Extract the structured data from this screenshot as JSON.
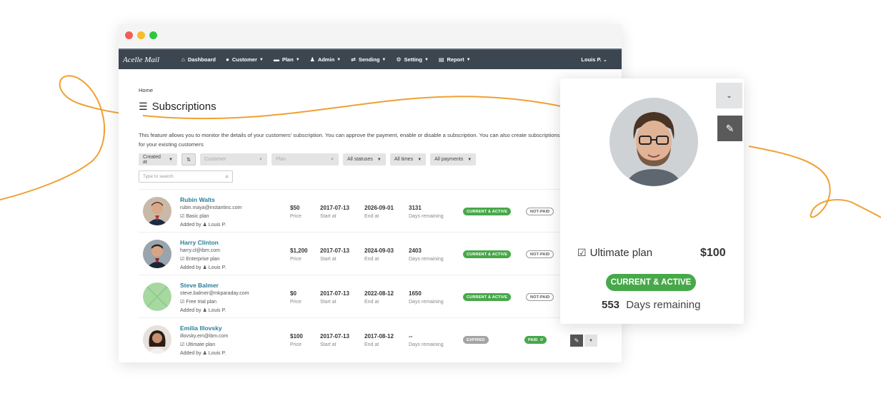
{
  "window": {
    "title_dots": [
      "red",
      "yellow",
      "green"
    ]
  },
  "brand": "Acelle Mail",
  "nav": [
    {
      "label": "Dashboard",
      "icon": "home-icon",
      "caret": false
    },
    {
      "label": "Customer",
      "icon": "user-icon",
      "caret": true
    },
    {
      "label": "Plan",
      "icon": "card-icon",
      "caret": true
    },
    {
      "label": "Admin",
      "icon": "admin-icon",
      "caret": true
    },
    {
      "label": "Sending",
      "icon": "exchange-icon",
      "caret": true
    },
    {
      "label": "Setting",
      "icon": "gear-icon",
      "caret": true
    },
    {
      "label": "Report",
      "icon": "report-icon",
      "caret": true
    }
  ],
  "user_menu": "Louis P. ⌄",
  "breadcrumb": "Home",
  "page_title": "Subscriptions",
  "description": "This feature allows you to monitor the details of your customers' subscription. You can approve the payment, enable or disable a subscription. You can also create subscriptions for your existing customers",
  "filters": {
    "created_at": "Created at",
    "customer": "Customer",
    "plan": "Plan",
    "statuses": "All statuses",
    "times": "All times",
    "payments": "All payments",
    "search_placeholder": "Type to search"
  },
  "labels": {
    "price": "Price",
    "start": "Start at",
    "end": "End at",
    "remaining": "Days remaining",
    "added_by": "Added by",
    "added_user": "Louis P."
  },
  "subscriptions": [
    {
      "name": "Rubin Walts",
      "email": "rubin.maya@instantinc.com",
      "plan": "Basic plan",
      "price": "$50",
      "start": "2017-07-13",
      "end": "2026-09-01",
      "days": "3131",
      "status": "CURRENT & ACTIVE",
      "payment": "NOT-PAID"
    },
    {
      "name": "Harry Clinton",
      "email": "harry.cl@ibm.com",
      "plan": "Enterprise plan",
      "price": "$1,200",
      "start": "2017-07-13",
      "end": "2024-09-03",
      "days": "2403",
      "status": "CURRENT & ACTIVE",
      "payment": "NOT-PAID"
    },
    {
      "name": "Steve Balmer",
      "email": "steve.balmer@mkparaday.com",
      "plan": "Free trial plan",
      "price": "$0",
      "start": "2017-07-13",
      "end": "2022-08-12",
      "days": "1650",
      "status": "CURRENT & ACTIVE",
      "payment": "NOT-PAID"
    },
    {
      "name": "Emilia Illovsky",
      "email": "illovsky.em@ibm.com",
      "plan": "Ultimate plan",
      "price": "$100",
      "start": "2017-07-13",
      "end": "2017-08-12",
      "days": "--",
      "status": "EXPIRED",
      "payment": "PAID"
    }
  ],
  "detail_card": {
    "plan": "Ultimate plan",
    "price": "$100",
    "status": "CURRENT & ACTIVE",
    "days": "553",
    "days_label": "Days remaining"
  },
  "colors": {
    "accent_green": "#47a84a",
    "navbar": "#3c4650",
    "link": "#2a7e99",
    "deco_orange": "#f0a033"
  }
}
